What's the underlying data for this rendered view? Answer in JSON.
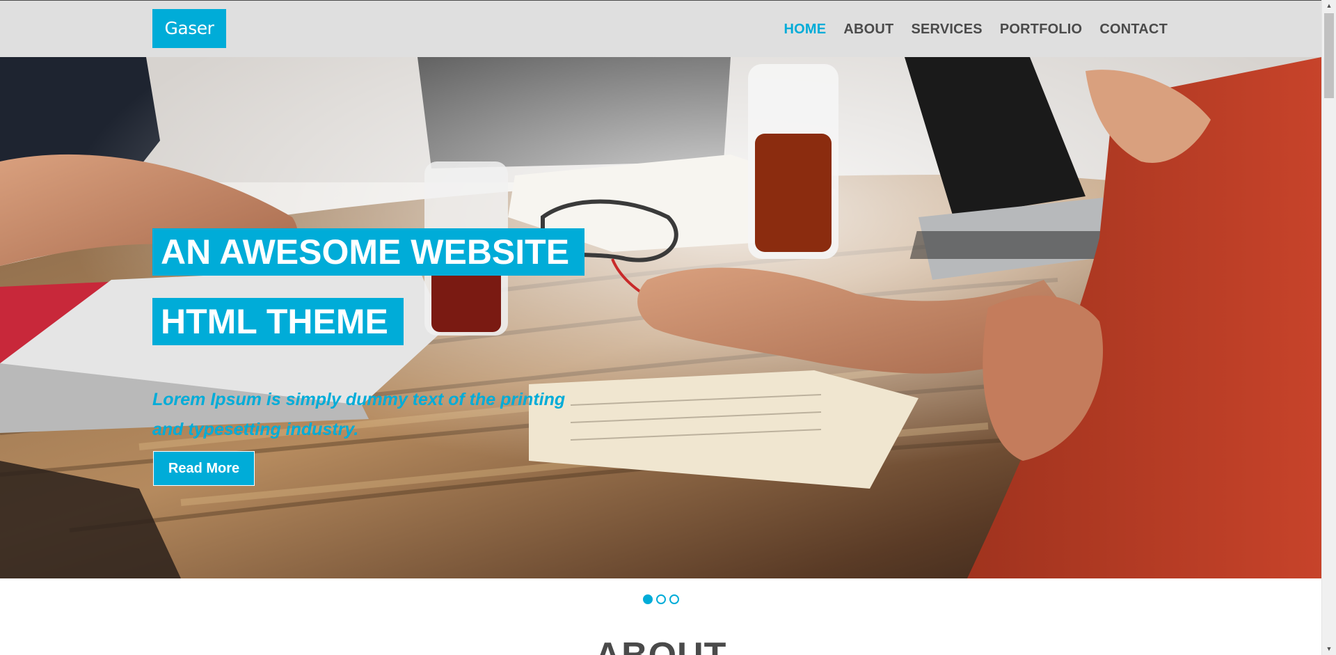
{
  "brand": {
    "name": "Gaser"
  },
  "nav": {
    "items": [
      {
        "label": "HOME",
        "active": true
      },
      {
        "label": "ABOUT",
        "active": false
      },
      {
        "label": "SERVICES",
        "active": false
      },
      {
        "label": "PORTFOLIO",
        "active": false
      },
      {
        "label": "CONTACT",
        "active": false
      }
    ]
  },
  "hero": {
    "headline_line1": "AN AWESOME WEBSITE",
    "headline_line2": "HTML THEME",
    "lead": "Lorem Ipsum is simply dummy text of the printing and typesetting industry.",
    "button_label": "Read More",
    "slides_total": 3,
    "active_slide": 1
  },
  "about": {
    "title": "ABOUT"
  },
  "colors": {
    "accent": "#00acd8",
    "navbar_bg": "#dfdfdf",
    "nav_text": "#4b4b4b",
    "heading_text": "#4a4a4a"
  }
}
